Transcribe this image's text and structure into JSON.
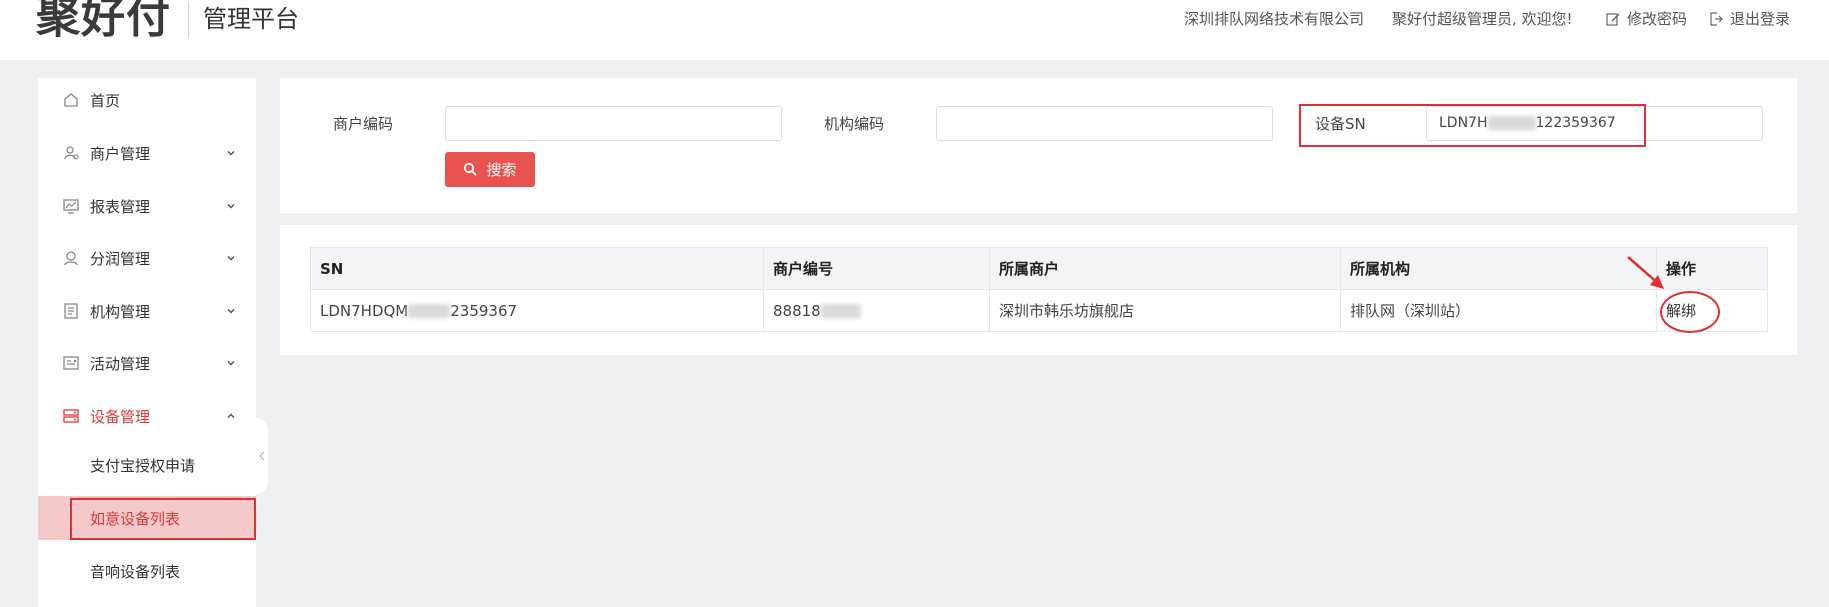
{
  "header": {
    "logo_text": "聚好付",
    "platform": "管理平台",
    "company": "深圳排队网络技术有限公司",
    "welcome": "聚好付超级管理员, 欢迎您!",
    "change_password": "修改密码",
    "logout": "退出登录"
  },
  "sidebar": {
    "items": [
      {
        "label": "首页",
        "icon": "home-icon"
      },
      {
        "label": "商户管理",
        "icon": "merchant-icon"
      },
      {
        "label": "报表管理",
        "icon": "report-icon"
      },
      {
        "label": "分润管理",
        "icon": "profit-icon"
      },
      {
        "label": "机构管理",
        "icon": "organization-icon"
      },
      {
        "label": "活动管理",
        "icon": "activity-icon"
      },
      {
        "label": "设备管理",
        "icon": "device-icon"
      }
    ],
    "sub_items": [
      {
        "label": "支付宝授权申请"
      },
      {
        "label": "如意设备列表"
      },
      {
        "label": "音响设备列表"
      }
    ]
  },
  "search": {
    "merchant_code_label": "商户编码",
    "merchant_code_value": "",
    "org_code_label": "机构编码",
    "org_code_value": "",
    "device_sn_label": "设备SN",
    "device_sn_prefix": "LDN7H",
    "device_sn_suffix": "122359367",
    "search_button": "搜索"
  },
  "table": {
    "headers": [
      "SN",
      "商户编号",
      "所属商户",
      "所属机构",
      "操作"
    ],
    "rows": [
      {
        "sn_prefix": "LDN7HDQM",
        "sn_suffix": "2359367",
        "merchant_no_prefix": "88818",
        "merchant": "深圳市韩乐坊旗舰店",
        "organization": "排队网（深圳站）",
        "action": "解绑"
      }
    ]
  },
  "colors": {
    "accent": "#e9534f",
    "annotation": "#e03030",
    "selected_bg": "#f4c9c9"
  }
}
